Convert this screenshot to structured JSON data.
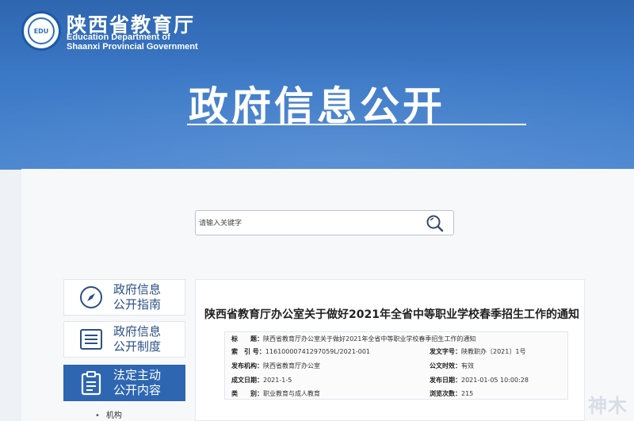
{
  "header": {
    "site_name": "陕西省教育厅",
    "site_name_en_line1": "Education Department of",
    "site_name_en_line2": "Shaanxi Provincial Government",
    "emblem_text": "EDU",
    "banner_title": "政府信息公开"
  },
  "search": {
    "placeholder": "请输入关键字",
    "icon": "search-icon"
  },
  "sidebar": {
    "items": [
      {
        "line1": "政府信息",
        "line2": "公开指南",
        "icon": "compass-icon",
        "active": false
      },
      {
        "line1": "政府信息",
        "line2": "公开制度",
        "icon": "list-icon",
        "active": false
      },
      {
        "line1": "法定主动",
        "line2": "公开内容",
        "icon": "clipboard-icon",
        "active": true
      }
    ],
    "sub_items": [
      "机构"
    ]
  },
  "article": {
    "title": "陕西省教育厅办公室关于做好2021年全省中等职业学校春季招生工作的通知",
    "meta": {
      "title_label": "标　　题：",
      "title_value": "陕西省教育厅办公室关于做好2021年全省中等职业学校春季招生工作的通知",
      "index_label": "索　引 号：",
      "index_value": "11610000741297059L/2021-001",
      "doc_no_label": "发文字号：",
      "doc_no_value": "陕教职办〔2021〕1号",
      "issuer_label": "发布机构：",
      "issuer_value": "陕西省教育厅办公室",
      "validity_label": "公文时效：",
      "validity_value": "有效",
      "date_label": "成文日期：",
      "date_value": "2021-1-5",
      "publish_label": "发布日期：",
      "publish_value": "2021-01-05 10:00:28",
      "category_label": "类　　别：",
      "category_value": "职业教育与成人教育",
      "views_label": "浏览次数：",
      "views_value": "215"
    }
  },
  "watermark": "神木",
  "colors": {
    "banner": "#3b78c6",
    "accent": "#2e66b2",
    "sidebar_text": "#2a4f86"
  }
}
